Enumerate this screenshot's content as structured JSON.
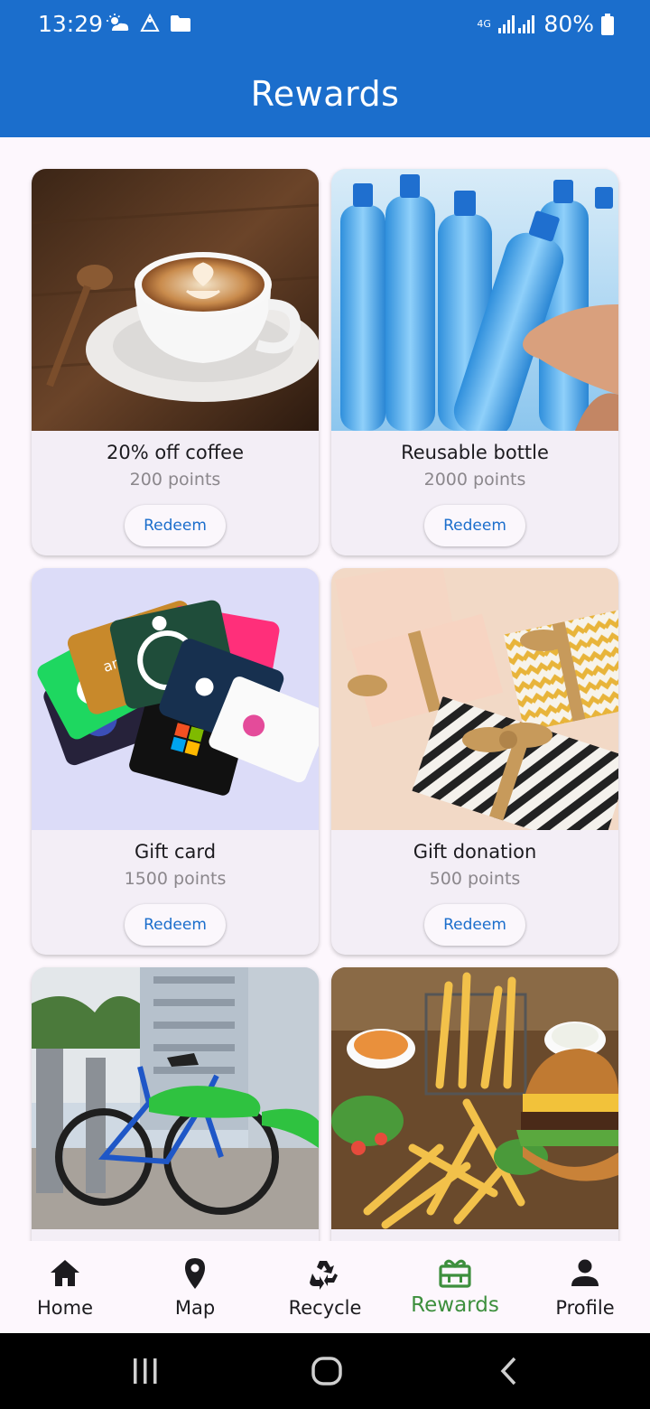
{
  "status_bar": {
    "time": "13:29",
    "network": "4G",
    "battery": "80%"
  },
  "header": {
    "title": "Rewards"
  },
  "rewards": [
    {
      "name": "20% off coffee",
      "points": "200 points",
      "action": "Redeem",
      "image": "coffee-image"
    },
    {
      "name": "Reusable bottle",
      "points": "2000 points",
      "action": "Redeem",
      "image": "water-bottles-image"
    },
    {
      "name": "Gift card",
      "points": "1500 points",
      "action": "Redeem",
      "image": "gift-cards-image"
    },
    {
      "name": "Gift donation",
      "points": "500 points",
      "action": "Redeem",
      "image": "gift-boxes-image"
    },
    {
      "image": "bicycle-image"
    },
    {
      "image": "burger-fries-image"
    }
  ],
  "bottom_nav": {
    "items": [
      {
        "label": "Home",
        "icon": "home-icon"
      },
      {
        "label": "Map",
        "icon": "map-pin-icon"
      },
      {
        "label": "Recycle",
        "icon": "recycle-icon"
      },
      {
        "label": "Rewards",
        "icon": "rewards-icon",
        "active": true
      },
      {
        "label": "Profile",
        "icon": "person-icon"
      }
    ]
  },
  "colors": {
    "primary": "#1b6ecc",
    "active_nav": "#3d8f3d",
    "card_bg": "#f3eef6",
    "page_bg": "#fdf7fd"
  }
}
